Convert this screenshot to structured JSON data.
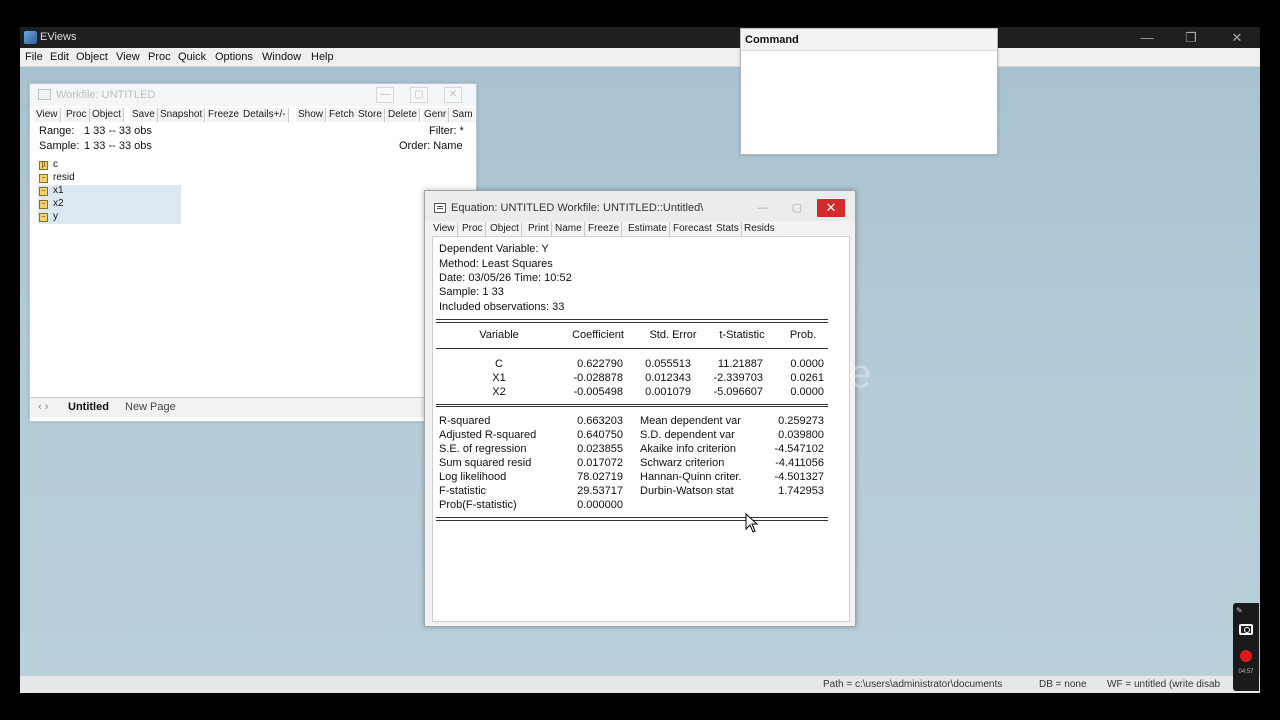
{
  "app": {
    "title": "EViews",
    "menu": [
      "File",
      "Edit",
      "Object",
      "View",
      "Proc",
      "Quick",
      "Options",
      "Window",
      "Help"
    ]
  },
  "workfile": {
    "title": "Workfile: UNTITLED",
    "toolbar": [
      "View",
      "Proc",
      "Object",
      "Save",
      "Snapshot",
      "Freeze",
      "Details+/-",
      "Show",
      "Fetch",
      "Store",
      "Delete",
      "Genr",
      "Sam"
    ],
    "range_label": "Range:",
    "range_value": "1 33  --  33 obs",
    "sample_label": "Sample:",
    "sample_value": "1 33  --  33 obs",
    "filter": "Filter: *",
    "order": "Order: Name",
    "objects": [
      {
        "icon": "beta-icon",
        "name": "c",
        "selected": false
      },
      {
        "icon": "series-icon",
        "name": "resid",
        "selected": false
      },
      {
        "icon": "series-icon",
        "name": "x1",
        "selected": true
      },
      {
        "icon": "series-icon",
        "name": "x2",
        "selected": true
      },
      {
        "icon": "series-icon",
        "name": "y",
        "selected": true
      }
    ],
    "tabs": {
      "nav": "‹ ›",
      "active": "Untitled",
      "new": "New Page"
    }
  },
  "command": {
    "title": "Command"
  },
  "equation": {
    "title": "Equation: UNTITLED   Workfile: UNTITLED::Untitled\\",
    "toolbar": [
      "View",
      "Proc",
      "Object",
      "Print",
      "Name",
      "Freeze",
      "Estimate",
      "Forecast",
      "Stats",
      "Resids"
    ],
    "header": [
      "Dependent Variable: Y",
      "Method: Least Squares",
      "Date: 03/05/26   Time: 10:52",
      "Sample: 1 33",
      "Included observations: 33"
    ],
    "columns": [
      "Variable",
      "Coefficient",
      "Std. Error",
      "t-Statistic",
      "Prob."
    ],
    "coefficients": [
      {
        "variable": "C",
        "coefficient": "0.622790",
        "std_error": "0.055513",
        "t_stat": "11.21887",
        "prob": "0.0000"
      },
      {
        "variable": "X1",
        "coefficient": "-0.028878",
        "std_error": "0.012343",
        "t_stat": "-2.339703",
        "prob": "0.0261"
      },
      {
        "variable": "X2",
        "coefficient": "-0.005498",
        "std_error": "0.001079",
        "t_stat": "-5.096607",
        "prob": "0.0000"
      }
    ],
    "stats": [
      {
        "label": "R-squared",
        "value": "0.663203",
        "label2": "Mean dependent var",
        "value2": "0.259273"
      },
      {
        "label": "Adjusted R-squared",
        "value": "0.640750",
        "label2": "S.D. dependent var",
        "value2": "0.039800"
      },
      {
        "label": "S.E. of regression",
        "value": "0.023855",
        "label2": "Akaike info criterion",
        "value2": "-4.547102"
      },
      {
        "label": "Sum squared resid",
        "value": "0.017072",
        "label2": "Schwarz criterion",
        "value2": "-4.411056"
      },
      {
        "label": "Log likelihood",
        "value": "78.02719",
        "label2": "Hannan-Quinn criter.",
        "value2": "-4.501327"
      },
      {
        "label": "F-statistic",
        "value": "29.53717",
        "label2": "Durbin-Watson stat",
        "value2": "1.742953"
      },
      {
        "label": "Prob(F-statistic)",
        "value": "0.000000",
        "label2": "",
        "value2": ""
      }
    ]
  },
  "statusbar": {
    "path": "Path = c:\\users\\administrator\\documents",
    "db": "DB = none",
    "wf": "WF = untitled (write disab"
  },
  "overlay": {
    "watermark": "te",
    "recorder_time": "04:57"
  }
}
